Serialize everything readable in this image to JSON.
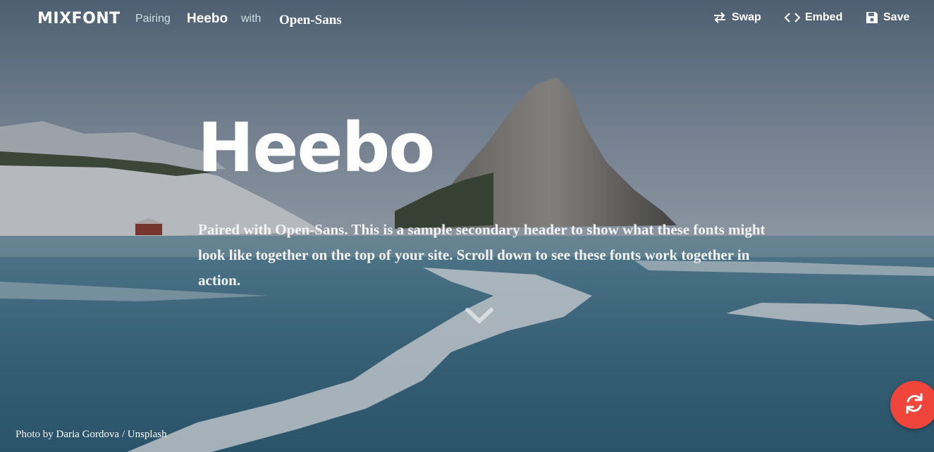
{
  "header": {
    "logo": "MIXFONT",
    "pairing_label": "Pairing",
    "heading_font": "Heebo",
    "with_label": "with",
    "body_font": "Open-Sans",
    "actions": {
      "swap": "Swap",
      "embed": "Embed",
      "save": "Save"
    }
  },
  "hero": {
    "title": "Heebo",
    "subtitle": "Paired with Open-Sans. This is a sample secondary header to show what these fonts might look like together on the top of your site. Scroll down to see these fonts work together in action."
  },
  "credit": {
    "prefix": "Photo by",
    "author": "Daria Gordova",
    "separator": "/",
    "source": "Unsplash"
  },
  "colors": {
    "accent": "#f0453a",
    "text": "#ffffff"
  },
  "icons": {
    "swap": "swap-icon",
    "embed": "code-icon",
    "save": "floppy-disk-icon",
    "scroll": "chevron-down-icon",
    "refresh": "refresh-icon"
  }
}
